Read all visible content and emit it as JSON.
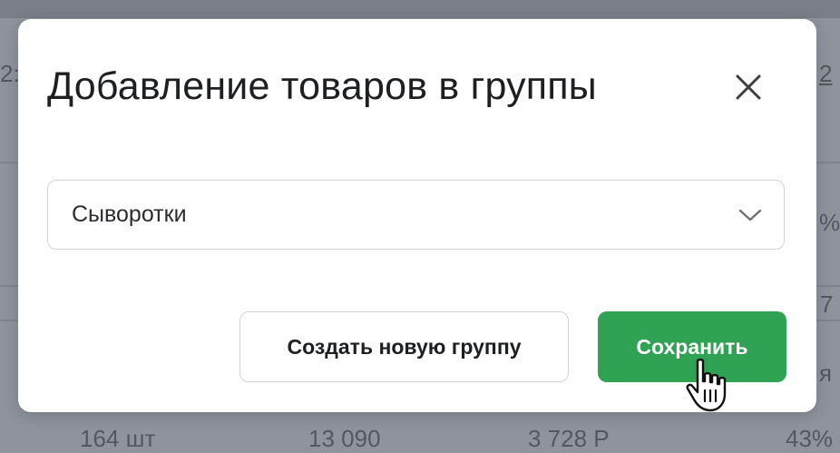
{
  "modal": {
    "title": "Добавление товаров в группы",
    "select": {
      "value": "Сыворотки"
    },
    "buttons": {
      "create_group": "Создать новую группу",
      "save": "Сохранить"
    }
  },
  "background": {
    "frag_left_1": "2:",
    "frag_right_1": "2",
    "frag_right_2": "%",
    "frag_right_3": "7",
    "frag_right_4": "я",
    "row_values": [
      "164 шт",
      "13 090",
      "3 728 Р",
      "43%"
    ]
  },
  "colors": {
    "overlay": "#8f949c",
    "primary": "#2fa253",
    "border": "#cfd3d8",
    "text": "#1d1f22"
  },
  "icons": {
    "close": "close-icon",
    "dropdown": "chevron-down-icon",
    "cursor": "hand-pointer-icon"
  }
}
